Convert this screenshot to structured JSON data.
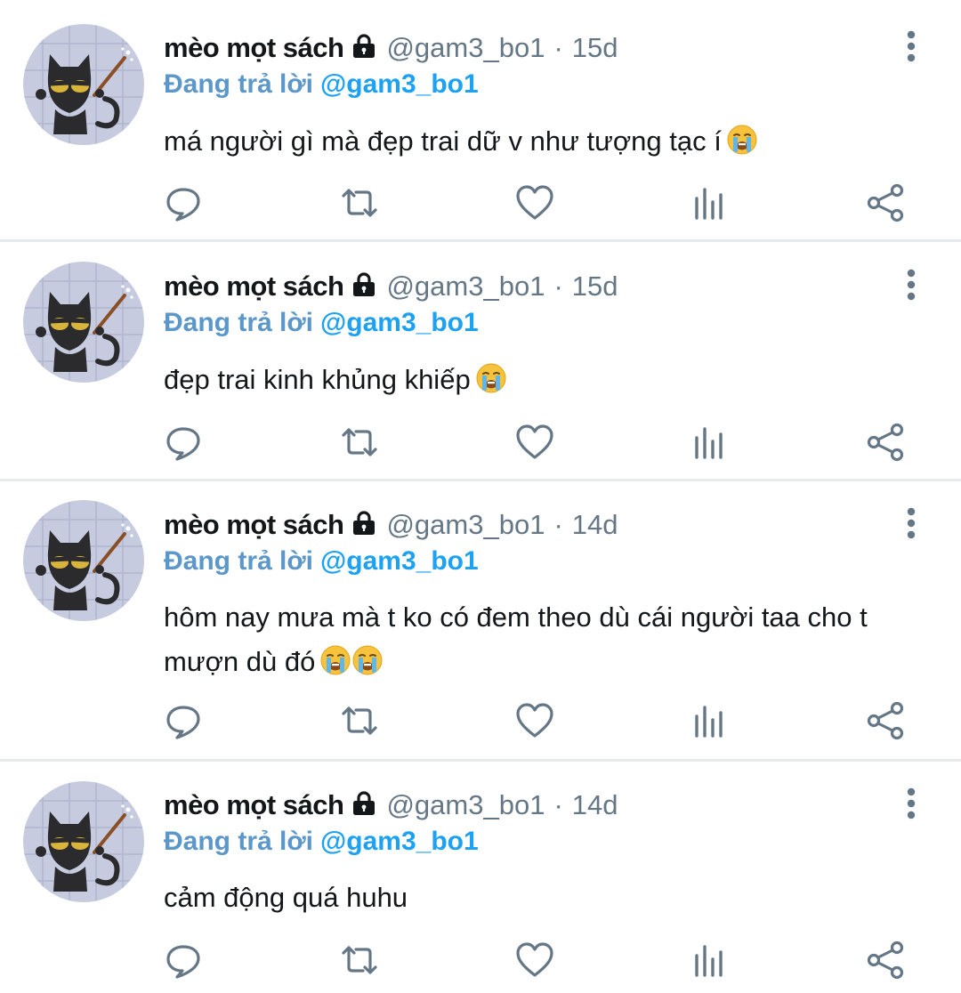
{
  "tweets": [
    {
      "name": "mèo mọt sách",
      "handle": "@gam3_bo1",
      "separator": "·",
      "time": "15d",
      "reply_label": "Đang trả lời",
      "reply_to": "@gam3_bo1",
      "text": "má người gì mà đẹp trai dữ v như tượng tạc í",
      "emoji": [
        "loudly-crying-face"
      ]
    },
    {
      "name": "mèo mọt sách",
      "handle": "@gam3_bo1",
      "separator": "·",
      "time": "15d",
      "reply_label": "Đang trả lời",
      "reply_to": "@gam3_bo1",
      "text": "đẹp trai kinh khủng khiếp",
      "emoji": [
        "loudly-crying-face"
      ]
    },
    {
      "name": "mèo mọt sách",
      "handle": "@gam3_bo1",
      "separator": "·",
      "time": "14d",
      "reply_label": "Đang trả lời",
      "reply_to": "@gam3_bo1",
      "text": "hôm nay mưa mà t ko có đem theo dù cái người taa cho t mượn dù đó",
      "emoji": [
        "loudly-crying-face",
        "loudly-crying-face"
      ]
    },
    {
      "name": "mèo mọt sách",
      "handle": "@gam3_bo1",
      "separator": "·",
      "time": "14d",
      "reply_label": "Đang trả lời",
      "reply_to": "@gam3_bo1",
      "text": "cảm động quá huhu",
      "emoji": []
    }
  ],
  "icons": {
    "lock": "lock-icon",
    "more": "more-vertical-icon",
    "actions": [
      "reply-icon",
      "retweet-icon",
      "like-icon",
      "analytics-icon",
      "share-icon"
    ]
  },
  "colors": {
    "name": "#14171a",
    "secondary": "#657786",
    "reply_label": "#5b97c9",
    "mention": "#1da1f2",
    "action_icon": "#657786",
    "divider": "#e6eaed"
  }
}
